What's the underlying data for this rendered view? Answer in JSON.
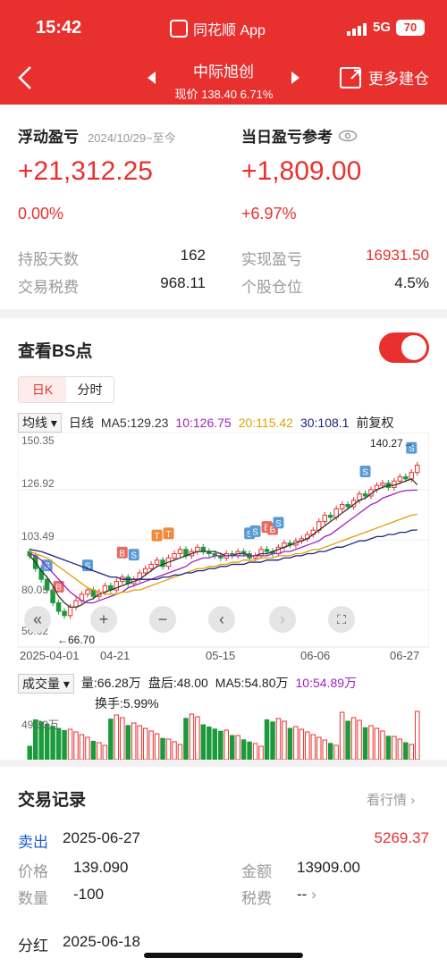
{
  "status": {
    "time": "15:42",
    "network": "5G",
    "battery": "70"
  },
  "app": {
    "name": "同花顺 App"
  },
  "header": {
    "stock_name": "中际旭创",
    "price_label": "现价",
    "price": "138.40",
    "change_pct": "6.71%",
    "suggest_label": "更多建仓"
  },
  "float": {
    "title": "浮动盈亏",
    "since": "2024/10/29~至今",
    "value": "+21,312.25",
    "pct": "0.00%"
  },
  "today": {
    "title": "当日盈亏参考",
    "value": "+1,809.00",
    "pct": "+6.97%"
  },
  "stats": {
    "hold_days_label": "持股天数",
    "hold_days": "162",
    "realized_label": "实现盈亏",
    "realized": "16931.50",
    "tax_label": "交易税费",
    "tax": "968.11",
    "position_label": "个股仓位",
    "position": "4.5%"
  },
  "bs": {
    "title": "查看BS点",
    "tab_day": "日K",
    "tab_time": "分时"
  },
  "kline_legend": {
    "mode": "均线",
    "period": "日线",
    "ma5": "MA5:129.23",
    "ma10": "10:126.75",
    "ma20": "20:115.42",
    "ma30": "30:108.1",
    "adjust": "前复权"
  },
  "price_axis": [
    "150.35",
    "126.92",
    "103.49",
    "80.05",
    "56.62"
  ],
  "annotations": {
    "high": "140.27→",
    "low": "←66.70"
  },
  "dates": [
    "2025-04-01",
    "04-21",
    "05-15",
    "06-06",
    "06-27"
  ],
  "volume_legend": {
    "mode": "成交量",
    "vol": "量:66.28万",
    "after": "盘后:48.00",
    "ma5": "MA5:54.80万",
    "ma10": "10:54.89万",
    "turnover": "换手:5.99%",
    "axis": "49.50万"
  },
  "bs_marks": {
    "buy": "B",
    "sell": "S",
    "t": "T"
  },
  "colors": {
    "red": "#e8312f",
    "green": "#1a9a3a",
    "ma5": "#333333",
    "ma10": "#a020c0",
    "ma20": "#e0a000",
    "ma30": "#1a237e"
  },
  "trades": {
    "title": "交易记录",
    "link": "看行情",
    "type": "卖出",
    "date": "2025-06-27",
    "amount": "5269.37",
    "price_label": "价格",
    "price": "139.090",
    "money_label": "金额",
    "money": "13909.00",
    "qty_label": "数量",
    "qty": "-100",
    "fee_label": "税费",
    "fee": "--",
    "div_label": "分红",
    "div_date": "2025-06-18"
  },
  "chart_data": {
    "type": "candlestick",
    "note_dates": [
      "2025-04-01",
      "04-21",
      "05-15",
      "06-06",
      "06-27"
    ],
    "ylim": [
      56.62,
      150.35
    ],
    "high": 140.27,
    "low": 66.7,
    "close": [
      96,
      90,
      85,
      80,
      74,
      70,
      68,
      72,
      75,
      78,
      80,
      77,
      79,
      82,
      80,
      84,
      86,
      83,
      85,
      88,
      90,
      92,
      94,
      91,
      95,
      97,
      99,
      96,
      98,
      100,
      98,
      97,
      96,
      95,
      97,
      96,
      98,
      97,
      95,
      96,
      99,
      98,
      97,
      100,
      102,
      101,
      103,
      104,
      106,
      108,
      112,
      115,
      114,
      118,
      120,
      119,
      122,
      125,
      124,
      127,
      129,
      130,
      128,
      131,
      133,
      132,
      135,
      138.4
    ],
    "ma5": [
      96,
      93,
      89,
      86,
      82,
      77,
      74,
      72,
      72,
      73,
      75,
      76,
      78,
      79,
      80,
      81,
      82,
      83,
      84,
      85,
      87,
      89,
      91,
      92,
      93,
      94,
      95,
      96,
      97,
      98,
      98,
      98,
      98,
      97,
      96,
      96,
      97,
      97,
      96,
      96,
      97,
      97,
      98,
      99,
      100,
      101,
      102,
      103,
      104,
      106,
      108,
      110,
      112,
      114,
      116,
      118,
      120,
      122,
      123,
      125,
      127,
      128,
      129,
      129,
      130,
      131,
      132,
      129.23
    ],
    "ma10": [
      97,
      96,
      94,
      91,
      88,
      85,
      82,
      79,
      77,
      75,
      74,
      74,
      75,
      76,
      77,
      78,
      79,
      81,
      82,
      83,
      84,
      85,
      86,
      87,
      88,
      89,
      90,
      91,
      93,
      94,
      95,
      95,
      96,
      96,
      96,
      96,
      96,
      96,
      96,
      96,
      96,
      96,
      97,
      97,
      98,
      98,
      99,
      100,
      101,
      102,
      103,
      105,
      106,
      108,
      110,
      112,
      114,
      116,
      118,
      120,
      121,
      123,
      124,
      125,
      126,
      126.5,
      126.7,
      126.75
    ],
    "ma20": [
      98,
      97,
      96,
      95,
      93,
      91,
      89,
      87,
      85,
      83,
      81,
      80,
      79,
      78,
      78,
      78,
      79,
      79,
      80,
      80,
      81,
      82,
      83,
      84,
      85,
      86,
      87,
      88,
      89,
      90,
      90,
      91,
      91,
      92,
      92,
      93,
      93,
      94,
      94,
      94,
      95,
      95,
      95,
      96,
      96,
      96,
      97,
      97,
      98,
      99,
      99,
      100,
      101,
      102,
      103,
      104,
      105,
      106,
      107,
      108,
      109,
      110,
      111,
      112,
      113,
      114,
      115,
      115.42
    ],
    "ma30": [
      99,
      98.5,
      98,
      97,
      96,
      95,
      94,
      93,
      92,
      91,
      90,
      89,
      88,
      87,
      86,
      86,
      85,
      85,
      85,
      85,
      85,
      85,
      85,
      86,
      86,
      87,
      87,
      88,
      88,
      89,
      89,
      90,
      90,
      91,
      91,
      92,
      92,
      92,
      93,
      93,
      93,
      94,
      94,
      94,
      95,
      95,
      96,
      96,
      97,
      97,
      98,
      98,
      99,
      100,
      100,
      101,
      102,
      103,
      103,
      104,
      105,
      105,
      106,
      106,
      107,
      107,
      108,
      108.1
    ]
  }
}
